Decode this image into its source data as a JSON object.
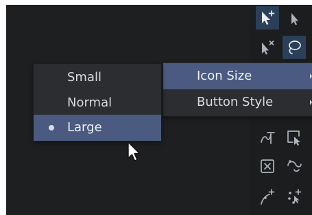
{
  "toolbar": {
    "tools": [
      {
        "name": "add-point-pointer-icon",
        "state": "active"
      },
      {
        "name": "pointer-icon",
        "state": "normal"
      },
      {
        "name": "remove-point-pointer-icon",
        "state": "normal"
      },
      {
        "name": "lasso-icon",
        "state": "active"
      },
      {
        "name": "curve-edit-icon",
        "state": "normal"
      },
      {
        "name": "select-frame-icon",
        "state": "normal"
      },
      {
        "name": "delete-box-icon",
        "state": "normal"
      },
      {
        "name": "rotate-point-icon",
        "state": "normal"
      },
      {
        "name": "add-bezier-point-icon",
        "state": "normal"
      },
      {
        "name": "move-points-icon",
        "state": "normal"
      }
    ],
    "colors": {
      "active_background": "#2b3f58",
      "icon": "#aeb4bd"
    }
  },
  "context_menu": {
    "items": [
      {
        "label": "Icon Size",
        "has_submenu": true,
        "highlighted": true
      },
      {
        "label": "Button Style",
        "has_submenu": true,
        "highlighted": false
      }
    ]
  },
  "icon_size_submenu": {
    "options": [
      {
        "label": "Small",
        "checked": false
      },
      {
        "label": "Normal",
        "checked": false
      },
      {
        "label": "Large",
        "checked": true
      }
    ],
    "selected": "Large"
  },
  "colors": {
    "canvas_background": "#1e1f21",
    "menu_background": "#2b2d30",
    "highlight": "#4a5a80",
    "text": "#d7dbe0"
  }
}
